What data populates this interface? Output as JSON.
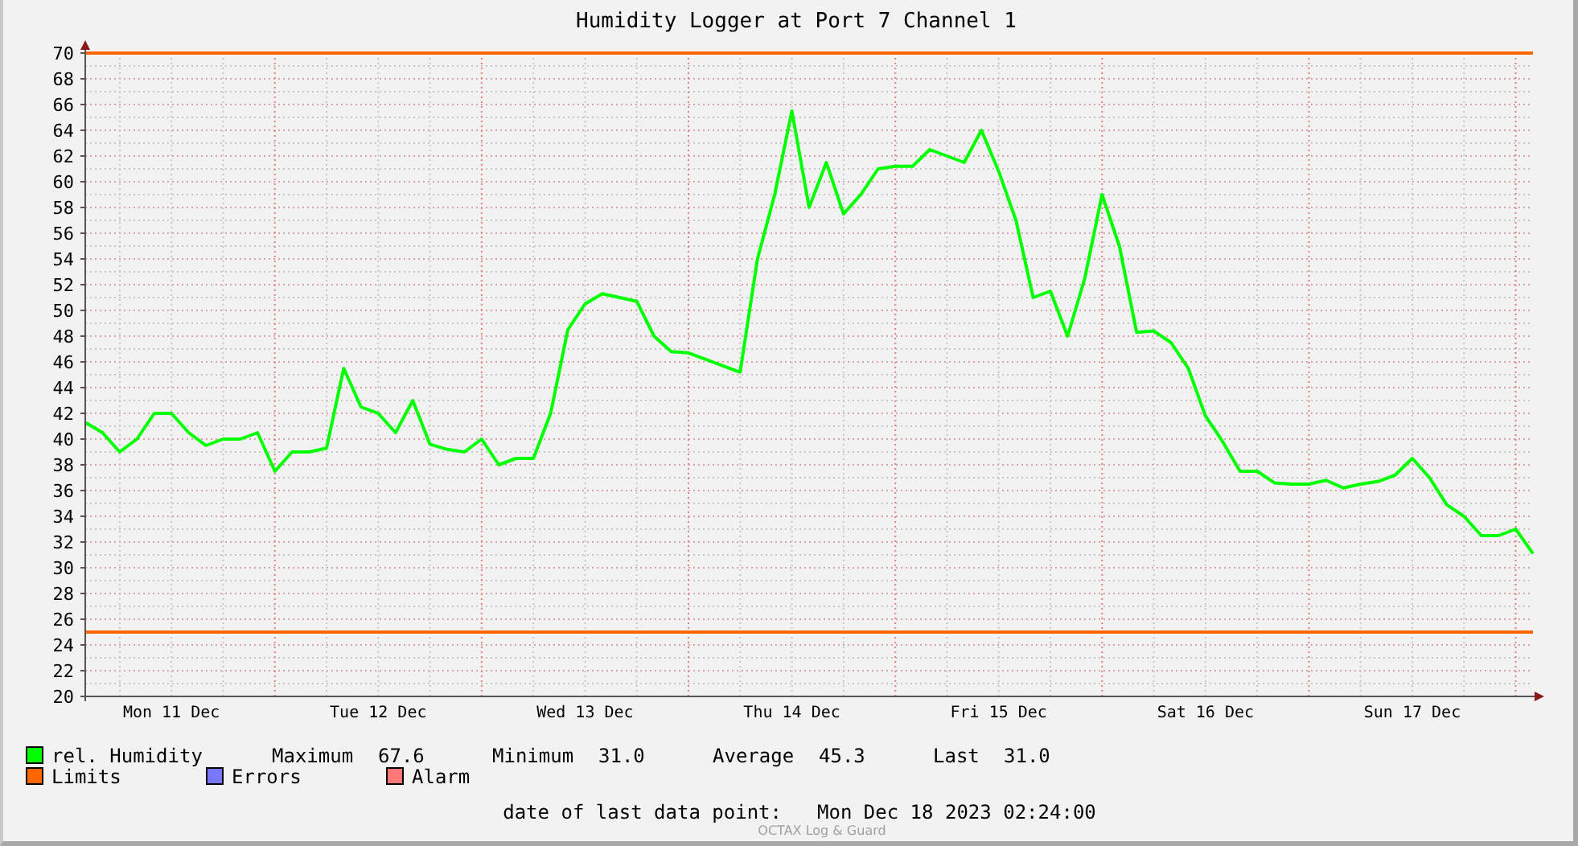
{
  "chart_data": {
    "type": "line",
    "title": "Humidity Logger at Port 7 Channel 1",
    "categories": [
      null,
      null,
      null,
      null,
      null,
      "Mon 11 Dec",
      null,
      null,
      null,
      null,
      null,
      null,
      null,
      null,
      null,
      null,
      null,
      "Tue 12 Dec",
      null,
      null,
      null,
      null,
      null,
      null,
      null,
      null,
      null,
      null,
      null,
      "Wed 13 Dec",
      null,
      null,
      null,
      null,
      null,
      null,
      null,
      null,
      null,
      null,
      null,
      "Thu 14 Dec",
      null,
      null,
      null,
      null,
      null,
      null,
      null,
      null,
      null,
      null,
      null,
      "Fri 15 Dec",
      null,
      null,
      null,
      null,
      null,
      null,
      null,
      null,
      null,
      null,
      null,
      "Sat 16 Dec",
      null,
      null,
      null,
      null,
      null,
      null,
      null,
      null,
      null,
      null,
      null,
      "Sun 17 Dec",
      null,
      null,
      null,
      null,
      null,
      null,
      null
    ],
    "series": [
      {
        "name": "rel. Humidity",
        "color": "#00ff00",
        "values": [
          41.3,
          40.5,
          39,
          40,
          42,
          42,
          40.5,
          39.5,
          40,
          40,
          40.5,
          37.5,
          39,
          39,
          39.3,
          45.5,
          42.5,
          42,
          40.5,
          43,
          39.6,
          39.2,
          39,
          40,
          38,
          38.5,
          38.5,
          42,
          48.5,
          50.5,
          51.3,
          51,
          50.7,
          48,
          46.8,
          46.7,
          46.2,
          45.7,
          45.2,
          54,
          59,
          65.5,
          58,
          61.5,
          57.5,
          59,
          61,
          61.2,
          61.2,
          62.5,
          62,
          61.5,
          64,
          60.8,
          57,
          51,
          51.5,
          48,
          52.5,
          59,
          55,
          48.3,
          48.4,
          47.5,
          45.5,
          41.8,
          39.8,
          37.5,
          37.5,
          36.6,
          36.5,
          36.5,
          36.8,
          36.2,
          36.5,
          36.7,
          37.2,
          38.5,
          37,
          34.9,
          34,
          32.5,
          32.5,
          33,
          31.1
        ]
      }
    ],
    "ylim": [
      20,
      70
    ],
    "yticks": [
      20,
      22,
      24,
      26,
      28,
      30,
      32,
      34,
      36,
      38,
      40,
      42,
      44,
      46,
      48,
      50,
      52,
      54,
      56,
      58,
      60,
      62,
      64,
      66,
      68,
      70
    ],
    "grid": true,
    "ref_lines": [
      {
        "axis": "y",
        "value": 70,
        "color": "#ff6600"
      },
      {
        "axis": "y",
        "value": 25,
        "color": "#ff6600"
      }
    ]
  },
  "legend_stats": [
    {
      "label": "Maximum",
      "value": "67.6"
    },
    {
      "label": "Minimum",
      "value": "31.0"
    },
    {
      "label": "Average",
      "value": "45.3"
    },
    {
      "label": "Last",
      "value": "31.0"
    }
  ],
  "legend": [
    {
      "label": "Limits",
      "color": "#ff6600"
    },
    {
      "label": "Errors",
      "color": "#7777ff"
    },
    {
      "label": "Alarm",
      "color": "#ff7777"
    }
  ],
  "last_data_point": {
    "label": "date of last data point:",
    "value": "Mon Dec 18 2023 02:24:00"
  },
  "credit": "OCTAX Log & Guard"
}
